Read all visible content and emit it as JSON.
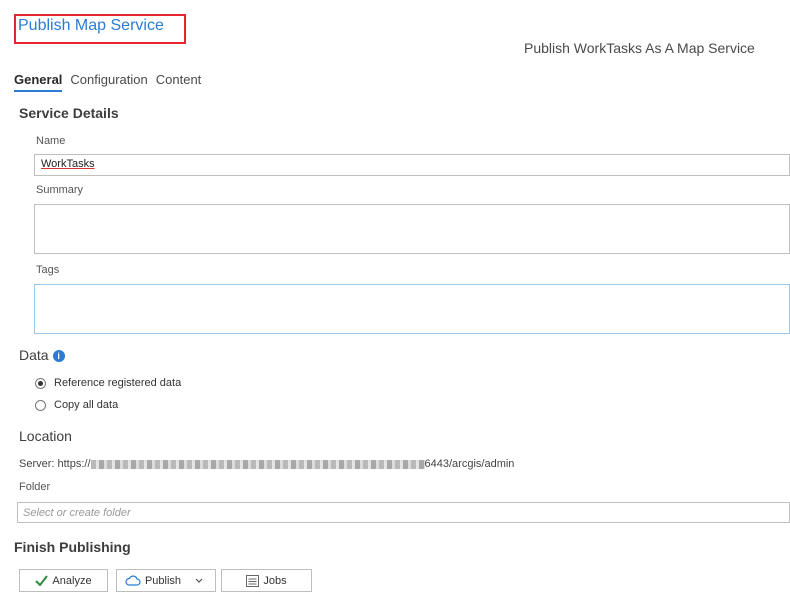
{
  "pane": {
    "title": "Publish Map Service",
    "subtitle": "Publish WorkTasks As A Map Service"
  },
  "tabs": [
    {
      "label": "General",
      "active": true
    },
    {
      "label": "Configuration",
      "active": false
    },
    {
      "label": "Content",
      "active": false
    }
  ],
  "service_details": {
    "heading": "Service Details",
    "name_label": "Name",
    "name_value": "WorkTasks",
    "summary_label": "Summary",
    "summary_value": "",
    "tags_label": "Tags",
    "tags_value": ""
  },
  "data_section": {
    "heading": "Data",
    "options": [
      {
        "label": "Reference registered data",
        "selected": true
      },
      {
        "label": "Copy all data",
        "selected": false
      }
    ]
  },
  "location": {
    "heading": "Location",
    "server_prefix": "Server: https://",
    "server_suffix": "6443/arcgis/admin",
    "folder_label": "Folder",
    "folder_placeholder": "Select or create folder"
  },
  "finish": {
    "heading": "Finish Publishing",
    "analyze_label": "Analyze",
    "publish_label": "Publish",
    "jobs_label": "Jobs"
  },
  "colors": {
    "accent": "#2b7cd3",
    "highlight_box": "#e5262d",
    "check": "#2e8b3a"
  }
}
